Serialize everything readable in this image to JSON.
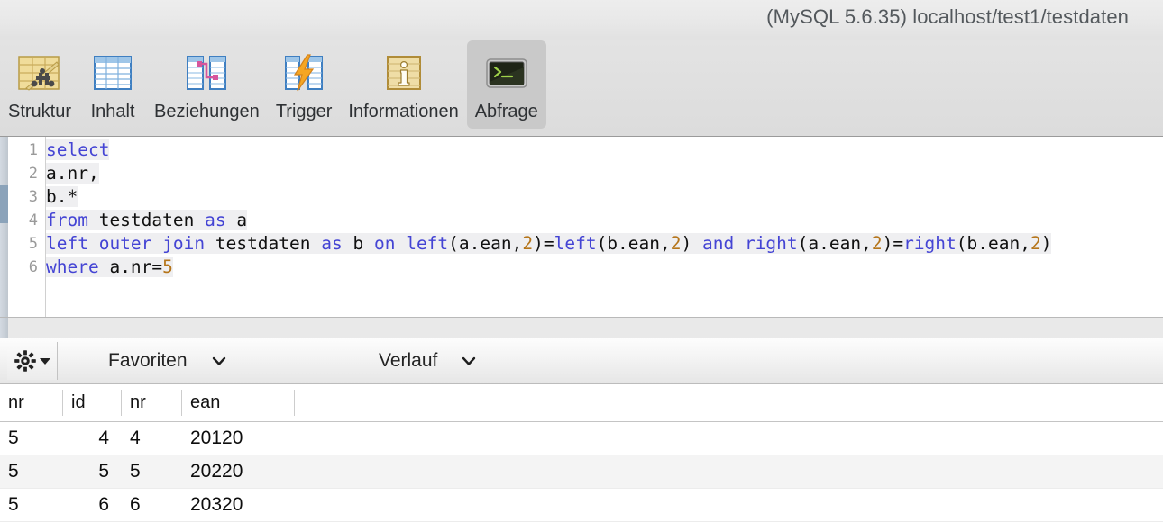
{
  "window": {
    "title": "(MySQL 5.6.35) localhost/test1/testdaten"
  },
  "toolbar": {
    "tabs": [
      {
        "label": "Struktur",
        "icon": "table-structure-icon",
        "selected": false
      },
      {
        "label": "Inhalt",
        "icon": "table-content-icon",
        "selected": false
      },
      {
        "label": "Beziehungen",
        "icon": "relations-icon",
        "selected": false
      },
      {
        "label": "Trigger",
        "icon": "trigger-icon",
        "selected": false
      },
      {
        "label": "Informationen",
        "icon": "information-icon",
        "selected": false
      },
      {
        "label": "Abfrage",
        "icon": "query-terminal-icon",
        "selected": true
      }
    ]
  },
  "editor": {
    "line_numbers": [
      "1",
      "2",
      "3",
      "4",
      "5",
      "6"
    ],
    "lines": [
      [
        {
          "t": "select",
          "c": "kw"
        }
      ],
      [
        {
          "t": "a.nr,",
          "c": "idt"
        }
      ],
      [
        {
          "t": "b.*",
          "c": "idt"
        }
      ],
      [
        {
          "t": "from ",
          "c": "kw"
        },
        {
          "t": "testdaten ",
          "c": "idt"
        },
        {
          "t": "as ",
          "c": "kw"
        },
        {
          "t": "a",
          "c": "idt"
        }
      ],
      [
        {
          "t": "left outer join ",
          "c": "kw"
        },
        {
          "t": "testdaten ",
          "c": "idt"
        },
        {
          "t": "as ",
          "c": "kw"
        },
        {
          "t": "b ",
          "c": "idt"
        },
        {
          "t": "on ",
          "c": "kw"
        },
        {
          "t": "left",
          "c": "kw"
        },
        {
          "t": "(a.ean,",
          "c": "idt"
        },
        {
          "t": "2",
          "c": "num"
        },
        {
          "t": ")=",
          "c": "idt"
        },
        {
          "t": "left",
          "c": "kw"
        },
        {
          "t": "(b.ean,",
          "c": "idt"
        },
        {
          "t": "2",
          "c": "num"
        },
        {
          "t": ") ",
          "c": "idt"
        },
        {
          "t": "and ",
          "c": "kw"
        },
        {
          "t": "right",
          "c": "kw"
        },
        {
          "t": "(a.ean,",
          "c": "idt"
        },
        {
          "t": "2",
          "c": "num"
        },
        {
          "t": ")=",
          "c": "idt"
        },
        {
          "t": "right",
          "c": "kw"
        },
        {
          "t": "(b.ean,",
          "c": "idt"
        },
        {
          "t": "2",
          "c": "num"
        },
        {
          "t": ")",
          "c": "idt"
        }
      ],
      [
        {
          "t": "where ",
          "c": "kw"
        },
        {
          "t": "a.nr=",
          "c": "idt"
        },
        {
          "t": "5",
          "c": "num"
        }
      ]
    ],
    "full_query": "select\na.nr,\nb.*\nfrom testdaten as a\nleft outer join testdaten as b on left(a.ean,2)=left(b.ean,2) and right(a.ean,2)=right(b.ean,2)\nwhere a.nr=5"
  },
  "actionbar": {
    "gear_label": "gear-icon",
    "favorites_label": "Favoriten",
    "history_label": "Verlauf"
  },
  "results": {
    "columns": [
      "nr",
      "id",
      "nr",
      "ean",
      ""
    ],
    "rows": [
      [
        "5",
        "4",
        "4",
        "20120",
        ""
      ],
      [
        "5",
        "5",
        "5",
        "20220",
        ""
      ],
      [
        "5",
        "6",
        "6",
        "20320",
        ""
      ]
    ]
  },
  "colors": {
    "keyword": "#4444d4",
    "number": "#b5751a",
    "identifier": "#101010",
    "selected_tab_bg": "#c9c9c9",
    "row_stripe": "#f4f4f4"
  }
}
